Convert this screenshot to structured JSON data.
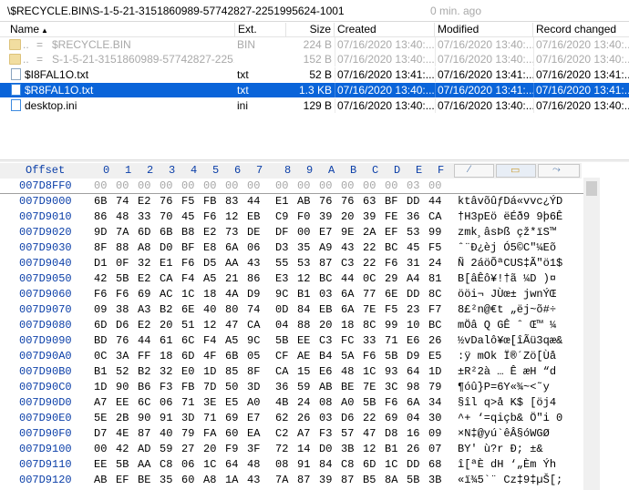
{
  "path": {
    "text": "\\$RECYCLE.BIN\\S-1-5-21-3151860989-57742827-2251995624-1001",
    "age": "0 min. ago"
  },
  "columns": {
    "name": "Name",
    "ext": "Ext.",
    "size": "Size",
    "created": "Created",
    "modified": "Modified",
    "record": "Record changed"
  },
  "files": [
    {
      "name": "$RECYCLE.BIN",
      "ext": "BIN",
      "size": "224 B",
      "created": "07/16/2020 13:40:...",
      "modified": "07/16/2020 13:40:...",
      "record": "07/16/2020 13:40:..."
    },
    {
      "name": "S-1-5-21-3151860989-57742827-2251...",
      "ext": "",
      "size": "152 B",
      "created": "07/16/2020 13:40:...",
      "modified": "07/16/2020 13:40:...",
      "record": "07/16/2020 13:40:..."
    },
    {
      "name": "$I8FAL1O.txt",
      "ext": "txt",
      "size": "52 B",
      "created": "07/16/2020 13:41:...",
      "modified": "07/16/2020 13:41:...",
      "record": "07/16/2020 13:41:..."
    },
    {
      "name": "$R8FAL1O.txt",
      "ext": "txt",
      "size": "1.3 KB",
      "created": "07/16/2020 13:40:...",
      "modified": "07/16/2020 13:41:...",
      "record": "07/16/2020 13:41:..."
    },
    {
      "name": "desktop.ini",
      "ext": "ini",
      "size": "129 B",
      "created": "07/16/2020 13:40:...",
      "modified": "07/16/2020 13:40:...",
      "record": "07/16/2020 13:40:..."
    }
  ],
  "parent_marker": "..",
  "parent_arrow": "=",
  "hex": {
    "offset_label": "Offset",
    "cols": [
      "0",
      "1",
      "2",
      "3",
      "4",
      "5",
      "6",
      "7",
      "8",
      "9",
      "A",
      "B",
      "C",
      "D",
      "E",
      "F"
    ],
    "rows": [
      {
        "off": "007D8FF0",
        "bytes": "00 00 00 00 00 00 00 00 00 00 00 00 00 00 03 00",
        "ascii": ""
      },
      {
        "off": "007D9000",
        "bytes": "6B 74 E2 76 F5 FB 83 44 E1 AB 76 76 63 BF DD 44",
        "ascii": "ktâvõûƒDá«vvc¿ÝD"
      },
      {
        "off": "007D9010",
        "bytes": "86 48 33 70 45 F6 12 EB C9 F0 39 20 39 FE 36 CA",
        "ascii": "†H3pEö ëÉð9 9þ6Ê"
      },
      {
        "off": "007D9020",
        "bytes": "9D 7A 6D 6B B8 E2 73 DE DF 00 E7 9E 2A EF 53 99",
        "ascii": " zmk¸âsÞß çž*ïS™"
      },
      {
        "off": "007D9030",
        "bytes": "8F 88 A8 D0 BF E8 6A 06 D3 35 A9 43 22 BC 45 F5",
        "ascii": " ˆ¨Ð¿èj Ó5©C\"¼Eõ"
      },
      {
        "off": "007D9040",
        "bytes": "D1 0F 32 E1 F6 D5 AA 43 55 53 87 C3 22 F6 31 24",
        "ascii": "Ñ 2áöÕªCUS‡Ã\"ö1$"
      },
      {
        "off": "007D9050",
        "bytes": "42 5B E2 CA F4 A5 21 86 E3 12 BC 44 0C 29 A4 81",
        "ascii": "B[âÊô¥!†ã ¼D )¤ "
      },
      {
        "off": "007D9060",
        "bytes": "F6 F6 69 AC 1C 18 4A D9 9C B1 03 6A 77 6E DD 8C",
        "ascii": "ööi¬  JÙœ± jwnÝŒ"
      },
      {
        "off": "007D9070",
        "bytes": "09 38 A3 B2 6E 40 80 74 0D 84 EB 6A 7E F5 23 F7",
        "ascii": " 8£²n@€t „ëj~õ#÷"
      },
      {
        "off": "007D9080",
        "bytes": "6D D6 E2 20 51 12 47 CA 04 88 20 18 8C 99 10 BC",
        "ascii": "mÖâ Q GÊ ˆ  Œ™ ¼"
      },
      {
        "off": "007D9090",
        "bytes": "BD 76 44 61 6C F4 A5 9C 5B EE C3 FC 33 71 E6 26",
        "ascii": "½vDalô¥œ[îÃü3qæ&"
      },
      {
        "off": "007D90A0",
        "bytes": "0C 3A FF 18 6D 4F 6B 05 CF AE B4 5A F6 5B D9 E5",
        "ascii": " :ÿ mOk Ï®´Zö[Ùå"
      },
      {
        "off": "007D90B0",
        "bytes": "B1 52 B2 32 E0 1D 85 8F CA 15 E6 48 1C 93 64 1D",
        "ascii": "±R²2à … Ê æH “d "
      },
      {
        "off": "007D90C0",
        "bytes": "1D 90 B6 F3 FB 7D 50 3D 36 59 AB BE 7E 3C 98 79",
        "ascii": " ¶óû}P=6Y«¾~<˜y"
      },
      {
        "off": "007D90D0",
        "bytes": "A7 EE 6C 06 71 3E E5 A0 4B 24 08 A0 5B F6 6A 34",
        "ascii": "§îl q>å K$  [öj4"
      },
      {
        "off": "007D90E0",
        "bytes": "5E 2B 90 91 3D 71 69 E7 62 26 03 D6 22 69 04 30",
        "ascii": "^+ ‘=qiçb& Ö\"i 0"
      },
      {
        "off": "007D90F0",
        "bytes": "D7 4E 87 40 79 FA 60 EA C2 A7 F3 57 47 D8 16 09",
        "ascii": "×N‡@yú`êÂ§óWGØ  "
      },
      {
        "off": "007D9100",
        "bytes": "00 42 AD 59 27 20 F9 3F 72 14 D0 3B 12 B1 26 07",
        "ascii": " B­Y' ù?r Ð; ±& "
      },
      {
        "off": "007D9110",
        "bytes": "EE 5B AA C8 06 1C 64 48 08 91 84 C8 6D 1C DD 68",
        "ascii": "î[ªÈ  dH ‘„Èm Ýh"
      },
      {
        "off": "007D9120",
        "bytes": "AB EF BE 35 60 A8 1A 43 7A 87 39 87 B5 8A 5B 3B",
        "ascii": "«ï¾5`¨ Cz‡9‡µŠ[;"
      }
    ]
  },
  "colors": {
    "selection": "#0a64d9",
    "offset_blue": "#0a3ea8",
    "folder_yellow": "#e8c15a"
  },
  "icons": [
    "folder-icon",
    "text-file-icon",
    "ini-file-icon",
    "sort-arrow-icon"
  ]
}
